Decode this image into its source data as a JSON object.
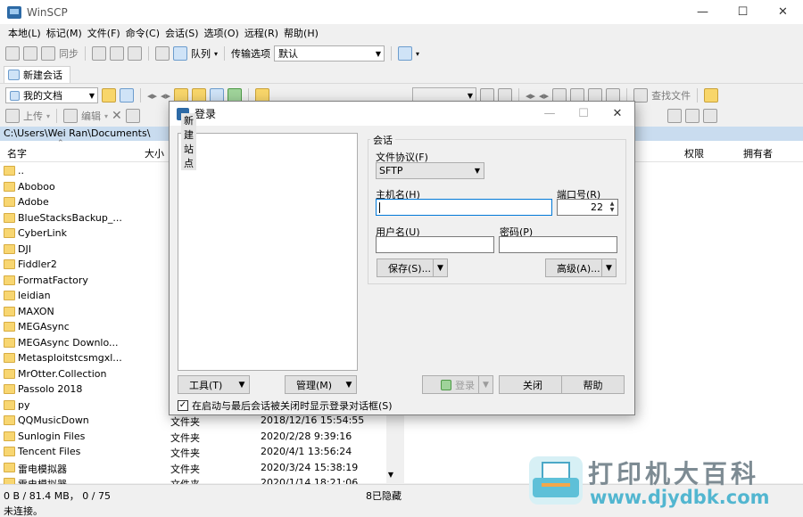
{
  "window": {
    "title": "WinSCP",
    "controls": [
      "—",
      "☐",
      "✕"
    ]
  },
  "menu": [
    "本地(L)",
    "标记(M)",
    "文件(F)",
    "命令(C)",
    "会话(S)",
    "选项(O)",
    "远程(R)",
    "帮助(H)"
  ],
  "toolbar1": {
    "sync": "同步",
    "queue": "队列",
    "transfer_label": "传输选项",
    "transfer_value": "默认"
  },
  "tab": {
    "label": "新建会话"
  },
  "toolbar_local": {
    "location": "我的文档",
    "find": "查找文件"
  },
  "toolbar_local2": {
    "upload": "上传",
    "edit": "编辑"
  },
  "local_path": "C:\\Users\\Wei Ran\\Documents\\",
  "left_columns": {
    "name": "名字",
    "size": "大小"
  },
  "right_columns": {
    "rights": "权限",
    "owner": "拥有者"
  },
  "files": [
    {
      "name": "..",
      "type": "",
      "date": ""
    },
    {
      "name": "Aboboo",
      "type": "",
      "date": ""
    },
    {
      "name": "Adobe",
      "type": "",
      "date": ""
    },
    {
      "name": "BlueStacksBackup_...",
      "type": "",
      "date": ""
    },
    {
      "name": "CyberLink",
      "type": "",
      "date": ""
    },
    {
      "name": "DJI",
      "type": "",
      "date": ""
    },
    {
      "name": "Fiddler2",
      "type": "",
      "date": ""
    },
    {
      "name": "FormatFactory",
      "type": "",
      "date": ""
    },
    {
      "name": "leidian",
      "type": "",
      "date": ""
    },
    {
      "name": "MAXON",
      "type": "",
      "date": ""
    },
    {
      "name": "MEGAsync",
      "type": "",
      "date": ""
    },
    {
      "name": "MEGAsync Downlo...",
      "type": "",
      "date": ""
    },
    {
      "name": "Metasploitstcsmgxl...",
      "type": "",
      "date": ""
    },
    {
      "name": "MrOtter.Collection",
      "type": "",
      "date": ""
    },
    {
      "name": "Passolo 2018",
      "type": "",
      "date": ""
    },
    {
      "name": "py",
      "type": "",
      "date": ""
    },
    {
      "name": "QQMusicDown",
      "type": "文件夹",
      "date": "2018/12/16  15:54:55"
    },
    {
      "name": "Sunlogin Files",
      "type": "文件夹",
      "date": "2020/2/28   9:39:16"
    },
    {
      "name": "Tencent Files",
      "type": "文件夹",
      "date": "2020/4/1   13:56:24"
    },
    {
      "name": "雷电模拟器",
      "type": "文件夹",
      "date": "2020/3/24  15:38:19"
    },
    {
      "name": "雷电模拟器",
      "type": "文件夹",
      "date": "2020/1/14  18:21:06"
    }
  ],
  "status": {
    "left": "0 B / 81.4 MB，  0 / 75",
    "hidden": "8已隐藏",
    "bottom": "未连接。"
  },
  "dialog": {
    "title": "登录",
    "site": "新建站点",
    "session_group": "会话",
    "protocol_label": "文件协议(F)",
    "protocol_value": "SFTP",
    "host_label": "主机名(H)",
    "host_value": "",
    "port_label": "端口号(R)",
    "port_value": "22",
    "user_label": "用户名(U)",
    "user_value": "",
    "pass_label": "密码(P)",
    "pass_value": "",
    "save_btn": "保存(S)...",
    "advanced_btn": "高级(A)...",
    "tools_btn": "工具(T)",
    "manage_btn": "管理(M)",
    "login_btn": "登录",
    "close_btn": "关闭",
    "help_btn": "帮助",
    "checkbox_label": "在启动与最后会话被关闭时显示登录对话框(S)",
    "checkbox_checked": true
  },
  "watermark": {
    "title": "打印机大百科",
    "url": "www.djydbk.com"
  }
}
